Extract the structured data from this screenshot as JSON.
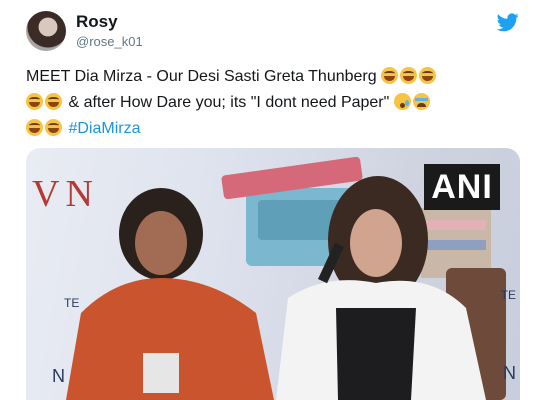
{
  "user": {
    "name": "Rosy",
    "handle": "@rose_k01"
  },
  "tweet": {
    "line1": "MEET Dia Mirza - Our Desi Sasti Greta Thunberg",
    "line2": "& after How Dare you; its \"I dont need Paper\"",
    "hashtag": "#DiaMirza"
  },
  "media": {
    "watermark": "ANI",
    "backdrop_letters": "VN",
    "left_edge_letter_1": "TE",
    "left_edge_letter_2": "N",
    "right_edge_letter_1": "TE",
    "right_edge_letter_2": "N"
  },
  "icons": {
    "brand": "twitter-bird-icon",
    "laugh": "face-with-tears-of-joy",
    "sad": "crying-face",
    "cry": "loudly-crying-face"
  },
  "colors": {
    "link": "#1b95e0",
    "handle": "#657786",
    "text": "#14171a",
    "brand": "#1da1f2"
  }
}
